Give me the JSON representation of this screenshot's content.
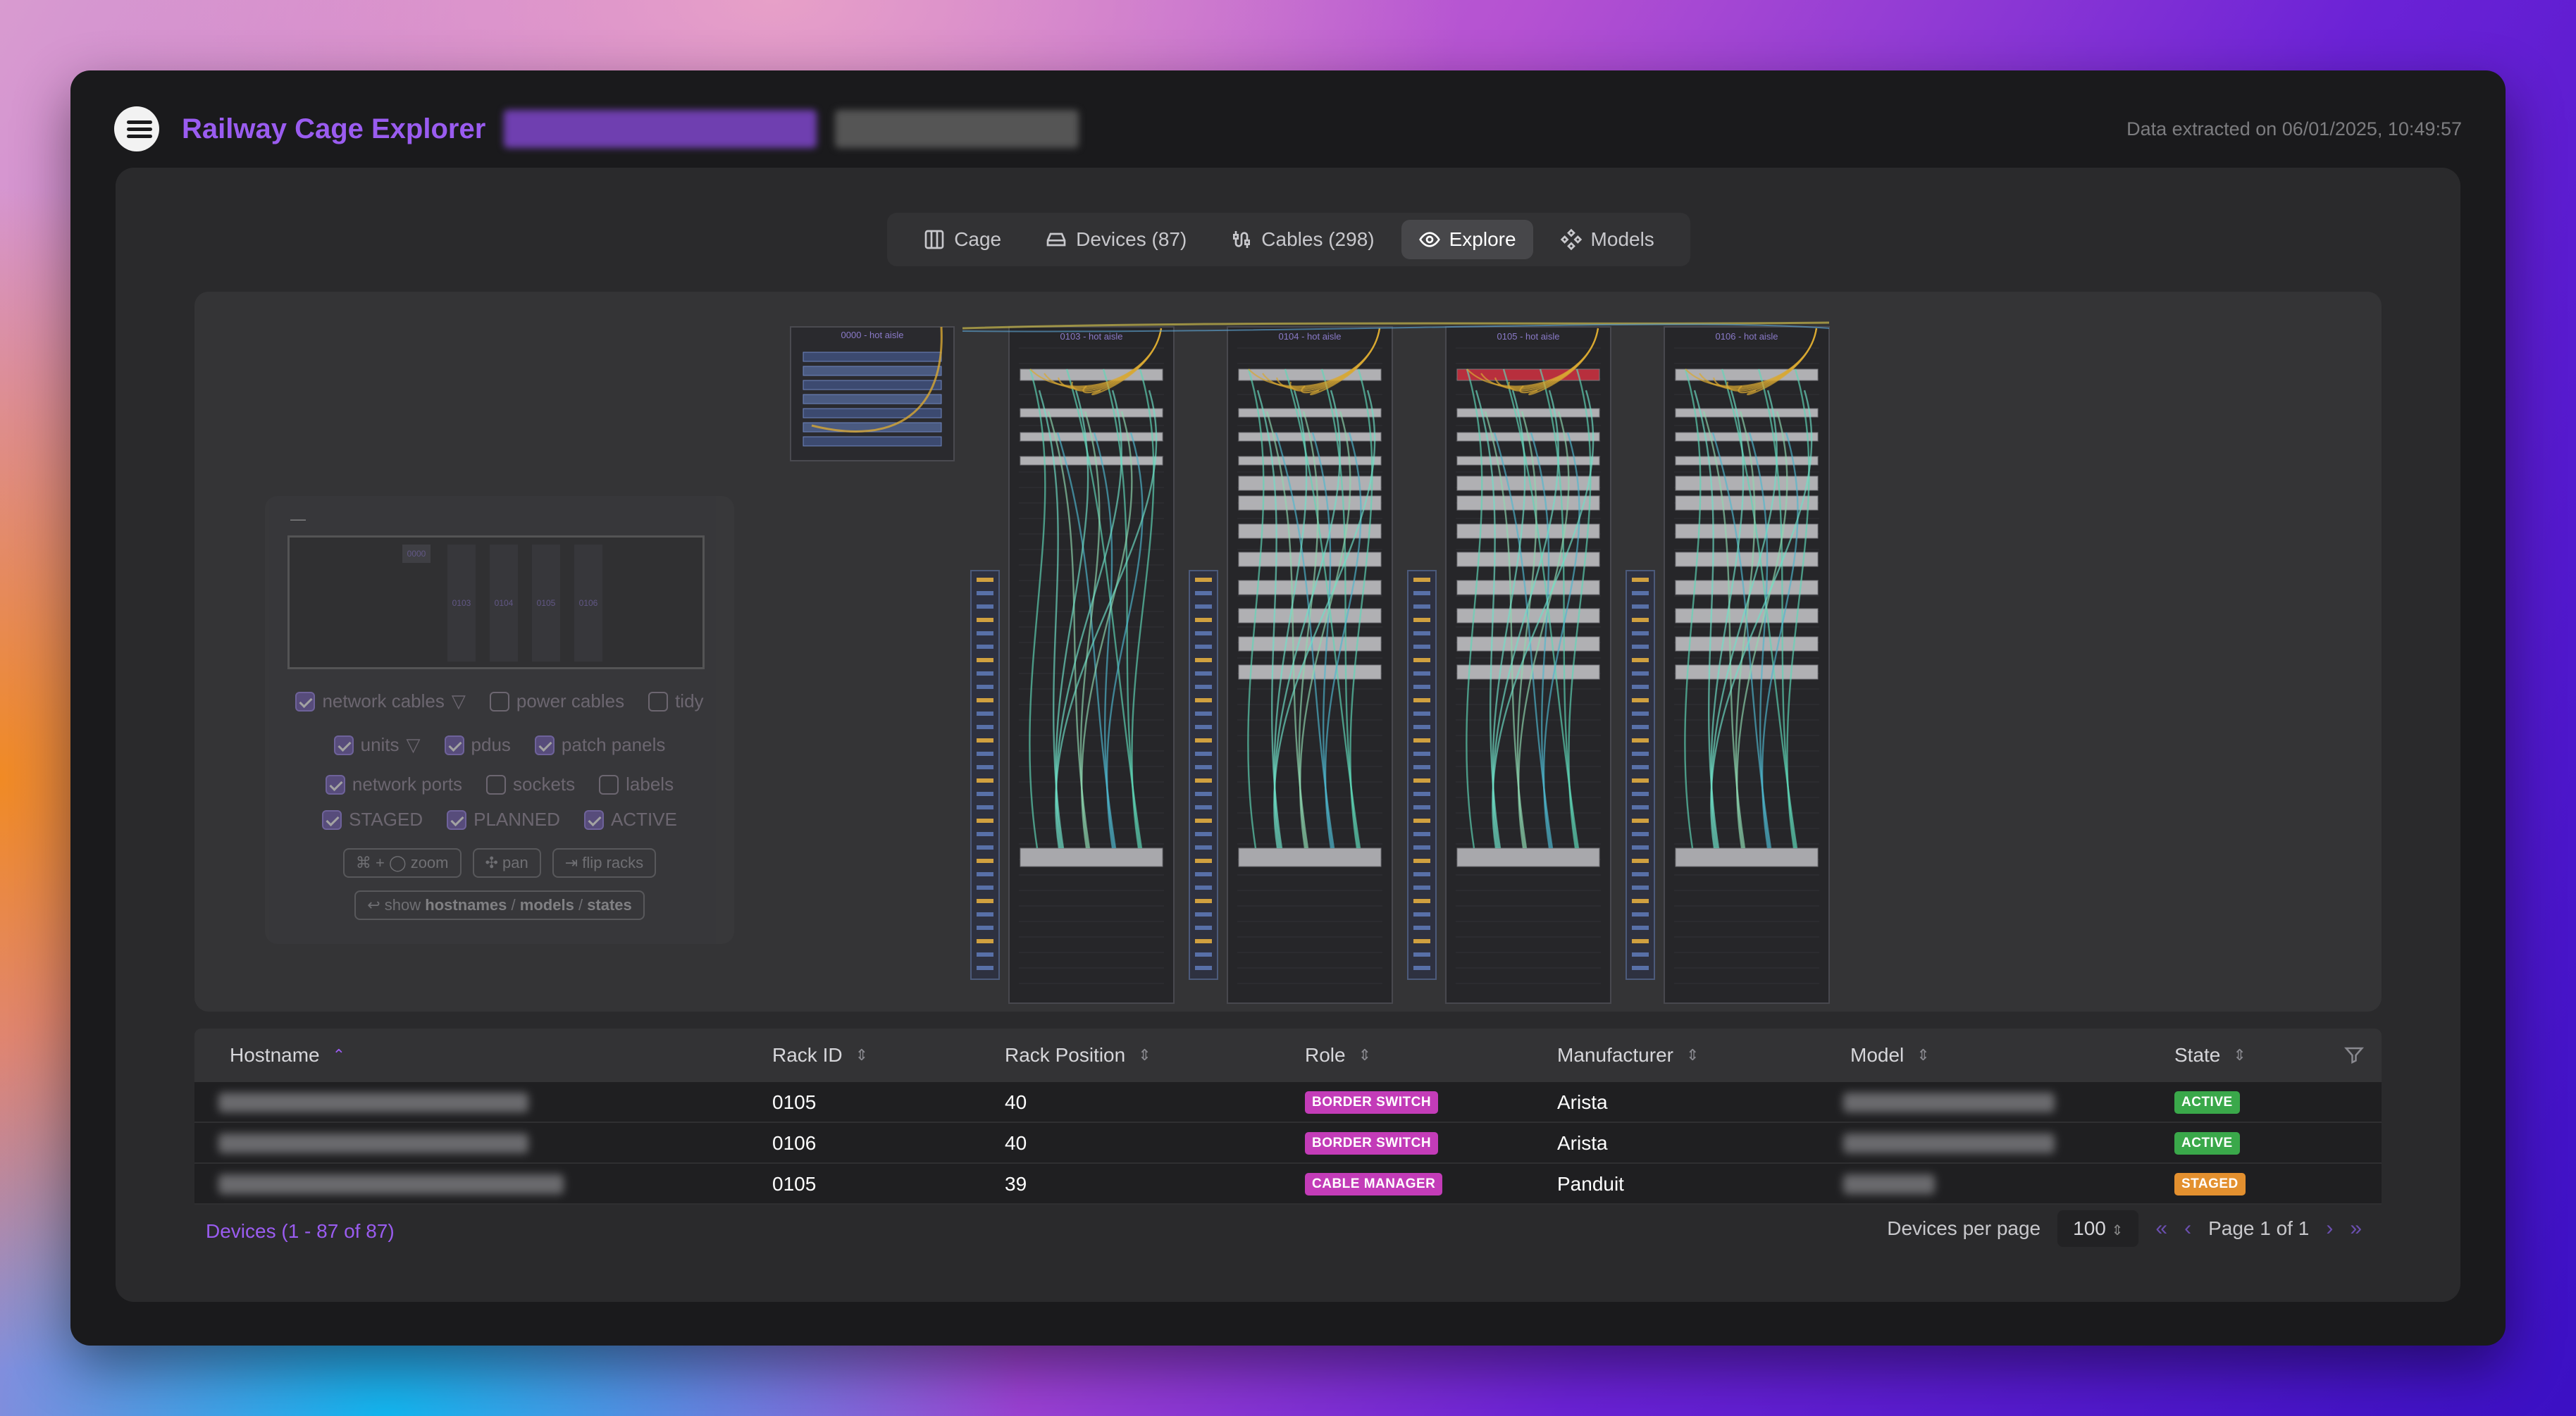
{
  "header": {
    "title": "Railway Cage Explorer",
    "extracted": "Data extracted on 06/01/2025, 10:49:57"
  },
  "tabs": [
    {
      "label": "Cage",
      "icon": "columns-icon"
    },
    {
      "label": "Devices (87)",
      "icon": "hard-drive-icon"
    },
    {
      "label": "Cables (298)",
      "icon": "cable-icon"
    },
    {
      "label": "Explore",
      "icon": "eye-icon",
      "active": true
    },
    {
      "label": "Models",
      "icon": "components-icon"
    }
  ],
  "racks": [
    {
      "id": "0000",
      "label": "0000 - hot aisle"
    },
    {
      "id": "0103",
      "label": "0103 - hot aisle"
    },
    {
      "id": "0104",
      "label": "0104 - hot aisle"
    },
    {
      "id": "0105",
      "label": "0105 - hot aisle"
    },
    {
      "id": "0106",
      "label": "0106 - hot aisle"
    }
  ],
  "minimap": {
    "dash": "—",
    "racks": [
      "0000",
      "0103",
      "0104",
      "0105",
      "0106"
    ],
    "options_row1": [
      {
        "label": "network cables",
        "checked": true,
        "filter": true
      },
      {
        "label": "power cables",
        "checked": false
      },
      {
        "label": "tidy",
        "checked": false
      }
    ],
    "options_row2": [
      {
        "label": "units",
        "checked": true,
        "filter": true
      },
      {
        "label": "pdus",
        "checked": true
      },
      {
        "label": "patch panels",
        "checked": true
      }
    ],
    "options_row3": [
      {
        "label": "network ports",
        "checked": true
      },
      {
        "label": "sockets",
        "checked": false
      },
      {
        "label": "labels",
        "checked": false
      }
    ],
    "options_row4": [
      {
        "label": "STAGED",
        "checked": true
      },
      {
        "label": "PLANNED",
        "checked": true
      },
      {
        "label": "ACTIVE",
        "checked": true
      }
    ],
    "zoom_hint": "⌘ + ◯ zoom",
    "pan_hint": "✣ pan",
    "flip_hint": "⇥ flip racks",
    "show_prefix": "↩ show",
    "show_hostnames": "hostnames",
    "show_slash1": "/",
    "show_models": "models",
    "show_slash2": "/",
    "show_states": "states"
  },
  "table": {
    "columns": {
      "hostname": "Hostname",
      "rack_id": "Rack ID",
      "rack_position": "Rack Position",
      "role": "Role",
      "manufacturer": "Manufacturer",
      "model": "Model",
      "state": "State"
    },
    "rows": [
      {
        "rack_id": "0105",
        "rack_position": "40",
        "role": "BORDER SWITCH",
        "manufacturer": "Arista",
        "state": "ACTIVE"
      },
      {
        "rack_id": "0106",
        "rack_position": "40",
        "role": "BORDER SWITCH",
        "manufacturer": "Arista",
        "state": "ACTIVE"
      },
      {
        "rack_id": "0105",
        "rack_position": "39",
        "role": "CABLE MANAGER",
        "manufacturer": "Panduit",
        "state": "STAGED"
      }
    ]
  },
  "footer": {
    "devices_count": "Devices (1 - 87 of 87)",
    "per_page_label": "Devices per page",
    "per_page_value": "100",
    "page_info": "Page 1 of 1"
  },
  "colors": {
    "accent": "#9a5cf0",
    "role_badge": "#c33cb8",
    "active": "#3aa84a",
    "staged": "#e3902f"
  }
}
